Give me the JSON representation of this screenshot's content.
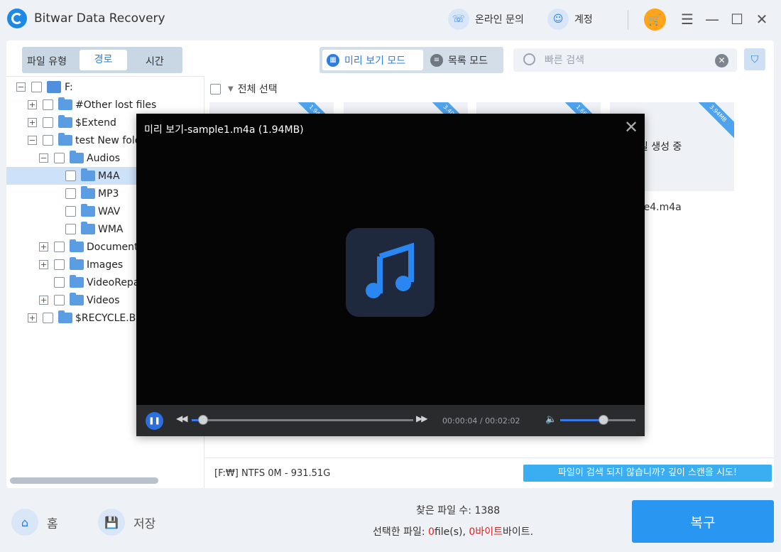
{
  "app": {
    "title": "Bitwar Data Recovery"
  },
  "titlebar": {
    "online_label": "온라인 문의",
    "account_label": "계정"
  },
  "filter_tabs": {
    "file_type": "파일 유형",
    "path": "경로",
    "time": "시간"
  },
  "view_modes": {
    "preview": "미리 보기 모드",
    "list": "목록 모드"
  },
  "search": {
    "placeholder": "빠른 검색",
    "value": ""
  },
  "tree": {
    "items": [
      {
        "label": "F:",
        "level": 0,
        "expand": "−"
      },
      {
        "label": "#Other lost files",
        "level": 1,
        "expand": "+"
      },
      {
        "label": "$Extend",
        "level": 1,
        "expand": "+"
      },
      {
        "label": "test New folder",
        "level": 1,
        "expand": "−"
      },
      {
        "label": "Audios",
        "level": 2,
        "expand": "−"
      },
      {
        "label": "M4A",
        "level": 3,
        "expand": "",
        "selected": true
      },
      {
        "label": "MP3",
        "level": 3,
        "expand": ""
      },
      {
        "label": "WAV",
        "level": 3,
        "expand": ""
      },
      {
        "label": "WMA",
        "level": 3,
        "expand": ""
      },
      {
        "label": "Documents",
        "level": 2,
        "expand": "+"
      },
      {
        "label": "Images",
        "level": 2,
        "expand": "+"
      },
      {
        "label": "VideoRepair",
        "level": 2,
        "expand": ""
      },
      {
        "label": "Videos",
        "level": 2,
        "expand": "+"
      },
      {
        "label": "$RECYCLE.BIN",
        "level": 1,
        "expand": "+"
      }
    ]
  },
  "content": {
    "select_all": "전체 선택",
    "cards": [
      {
        "size": "1.94MB",
        "text": "",
        "name": ""
      },
      {
        "size": "3.40MB",
        "text": "",
        "name": ""
      },
      {
        "size": "1.66MB",
        "text": "",
        "name": ""
      },
      {
        "size": "3.94MB",
        "text": "네일 생성 중",
        "name": "nple4.m4a"
      }
    ],
    "status": "[F:₩] NTFS 0M - 931.51G",
    "deep_scan": "파일이 검색 되지 않습니까? 깊이 스캔을 시도!"
  },
  "bottom": {
    "home": "홈",
    "save": "저장",
    "found_label": "찾은 파일 수: 1388",
    "selected_prefix": "선택한 파일: ",
    "selected_count": "0",
    "selected_files_unit": "file(s), ",
    "selected_bytes": "0바이트",
    "selected_bytes_unit": "바이트.",
    "recover": "복구"
  },
  "preview": {
    "title": "미리 보기-sample1.m4a (1.94MB)",
    "current_time": "00:00:04",
    "separator": "/",
    "total_time": "00:02:02",
    "progress": 0.05,
    "volume": 0.58,
    "accent": "#2e6fe0"
  }
}
